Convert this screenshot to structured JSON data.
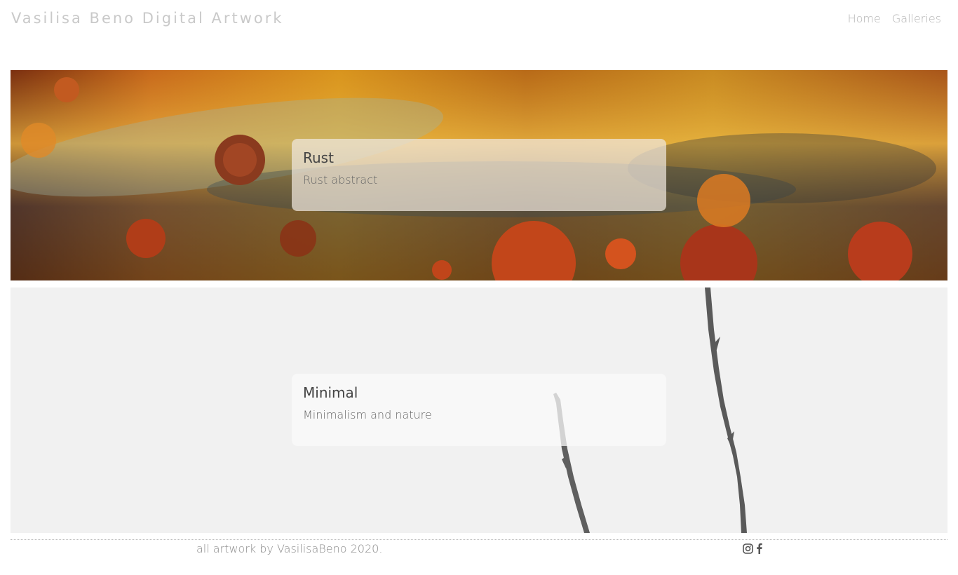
{
  "header": {
    "site_title": "Vasilisa Beno Digital Artwork",
    "nav": [
      {
        "label": "Home"
      },
      {
        "label": "Galleries"
      }
    ]
  },
  "galleries": [
    {
      "title": "Rust",
      "subtitle": "Rust abstract"
    },
    {
      "title": "Minimal",
      "subtitle": "Minimalism and nature"
    }
  ],
  "footer": {
    "credit": "all artwork by VasilisaBeno 2020.",
    "social_icons": [
      "instagram-icon",
      "facebook-icon"
    ]
  },
  "colors": {
    "title_text": "#c9c9c9",
    "nav_text": "#b3b3b3",
    "caption_title": "#444444",
    "caption_subtitle": "#666666",
    "rust_orange": "#c8781a",
    "minimal_gray": "#f1f1f1"
  }
}
